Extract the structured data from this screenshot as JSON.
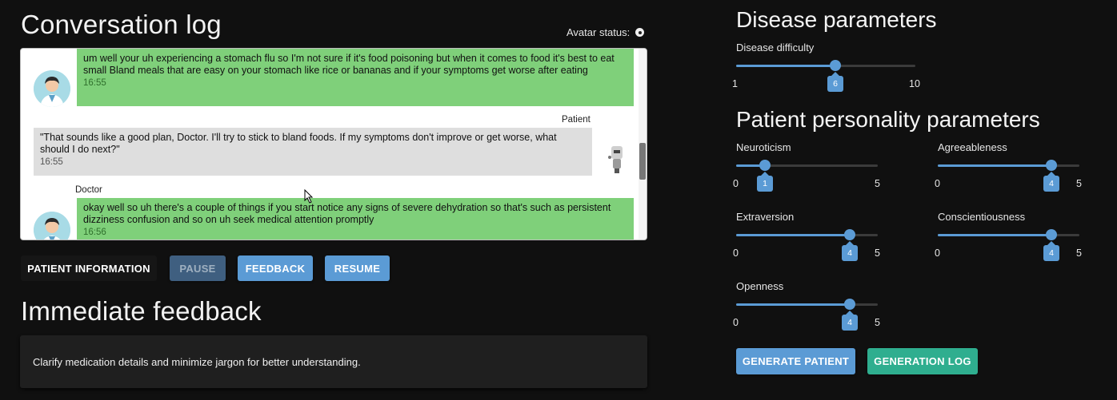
{
  "conversation": {
    "title": "Conversation log",
    "avatar_status_label": "Avatar status:",
    "messages": [
      {
        "role": "doctor",
        "sender": "",
        "text": "um well your uh experiencing a stomach flu so I'm not sure if it's food poisoning but when it comes to food it's best to eat small Bland meals that are easy on your stomach like rice or bananas and if your symptoms get worse after eating",
        "time": "16:55"
      },
      {
        "role": "patient",
        "sender": "Patient",
        "text": "\"That sounds like a good plan, Doctor. I'll try to stick to bland foods. If my symptoms don't improve or get worse, what should I do next?\"",
        "time": "16:55"
      },
      {
        "role": "doctor",
        "sender": "Doctor",
        "text": "okay well so uh there's a couple of things if you start notice any signs of severe dehydration so that's such as persistent dizziness confusion and so on uh seek medical attention promptly",
        "time": "16:56"
      }
    ]
  },
  "buttons": {
    "patient_information": "PATIENT INFORMATION",
    "pause": "PAUSE",
    "feedback": "FEEDBACK",
    "resume": "RESUME",
    "generate_patient": "GENERATE PATIENT",
    "generation_log": "GENERATION LOG"
  },
  "immediate_feedback": {
    "title": "Immediate feedback",
    "text": "Clarify medication details and minimize jargon for better understanding."
  },
  "disease": {
    "title": "Disease parameters",
    "difficulty": {
      "label": "Disease difficulty",
      "min": "1",
      "max": "10",
      "value": "6"
    }
  },
  "personality": {
    "title": "Patient personality parameters",
    "neuroticism": {
      "label": "Neuroticism",
      "min": "0",
      "max": "5",
      "value": "1"
    },
    "agreeableness": {
      "label": "Agreeableness",
      "min": "0",
      "max": "5",
      "value": "4"
    },
    "extraversion": {
      "label": "Extraversion",
      "min": "0",
      "max": "5",
      "value": "4"
    },
    "conscientiousness": {
      "label": "Conscientiousness",
      "min": "0",
      "max": "5",
      "value": "4"
    },
    "openness": {
      "label": "Openness",
      "min": "0",
      "max": "5",
      "value": "4"
    }
  },
  "colors": {
    "accent_blue": "#5b9bd5",
    "accent_teal": "#2fae8f",
    "doctor_bubble": "#7fd07a",
    "patient_bubble": "#dedede"
  },
  "icons": [
    "doctor-avatar-icon",
    "robot-avatar-icon",
    "mouse-cursor-icon",
    "status-dot-icon"
  ]
}
